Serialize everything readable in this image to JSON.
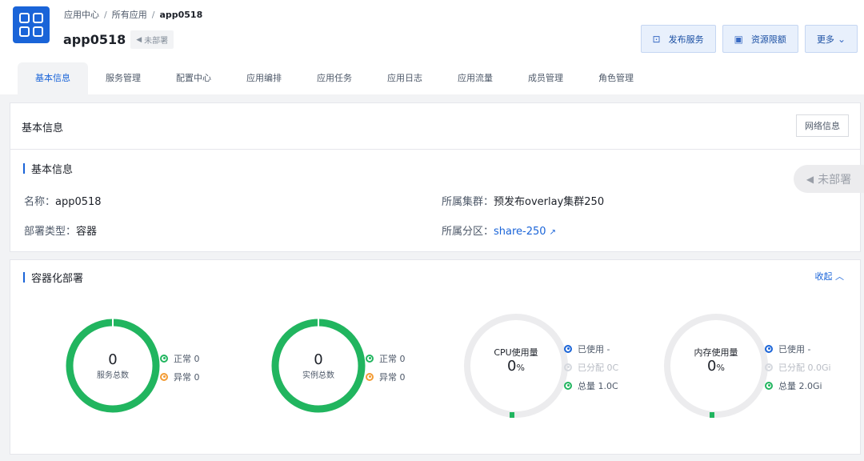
{
  "breadcrumb": {
    "home": "应用中心",
    "all": "所有应用",
    "current": "app0518"
  },
  "app": {
    "name": "app0518",
    "status": "未部署"
  },
  "actions": {
    "publish": "发布服务",
    "quota": "资源限额",
    "more": "更多"
  },
  "tabs": [
    "基本信息",
    "服务管理",
    "配置中心",
    "应用编排",
    "应用任务",
    "应用日志",
    "应用流量",
    "成员管理",
    "角色管理"
  ],
  "basic_card": {
    "title": "基本信息",
    "network_button": "网络信息",
    "section_title": "基本信息",
    "name_label": "名称：",
    "name_value": "app0518",
    "deploy_type_label": "部署类型：",
    "deploy_type_value": "容器",
    "cluster_label": "所属集群：",
    "cluster_value": "预发布overlay集群250",
    "partition_label": "所属分区：",
    "partition_value": "share-250",
    "status_tag": "未部署"
  },
  "deploy_card": {
    "section_title": "容器化部署",
    "collapse": "收起",
    "services": {
      "value": "0",
      "label": "服务总数",
      "normal": "正常 0",
      "abnormal": "异常 0",
      "percent_fill": 100
    },
    "instances": {
      "value": "0",
      "label": "实例总数",
      "normal": "正常 0",
      "abnormal": "异常 0",
      "percent_fill": 100
    },
    "cpu": {
      "label": "CPU使用量",
      "value": "0",
      "unit": "%",
      "used": "已使用 -",
      "allocated": "已分配 0C",
      "total": "总量 1.0C"
    },
    "memory": {
      "label": "内存使用量",
      "value": "0",
      "unit": "%",
      "used": "已使用 -",
      "allocated": "已分配 0.0Gi",
      "total": "总量 2.0Gi"
    }
  },
  "colors": {
    "accent": "#1a64d8",
    "green": "#21b55f",
    "orange": "#f39c35",
    "track": "#ececee"
  }
}
